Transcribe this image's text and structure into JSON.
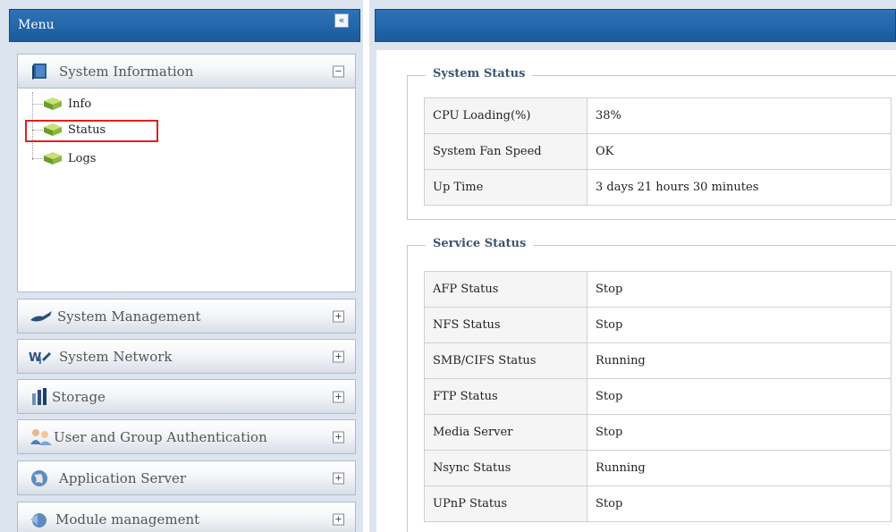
{
  "menu": {
    "title": "Menu",
    "collapse_icon": "double-chevron-left-icon",
    "sections": [
      {
        "label": "System Information",
        "icon": "book-icon",
        "toggle": "−",
        "expanded": true
      },
      {
        "label": "System Management",
        "icon": "wrench-icon",
        "toggle": "+"
      },
      {
        "label": "System Network",
        "icon": "network-icon",
        "toggle": "+"
      },
      {
        "label": "Storage",
        "icon": "storage-icon",
        "toggle": "+"
      },
      {
        "label": "User and Group Authentication",
        "icon": "users-icon",
        "toggle": "+"
      },
      {
        "label": "Application Server",
        "icon": "globe-icon",
        "toggle": "+"
      },
      {
        "label": "Module management",
        "icon": "module-icon",
        "toggle": "+"
      }
    ],
    "tree": [
      {
        "label": "Info",
        "icon": "cube-icon"
      },
      {
        "label": "Status",
        "icon": "cube-icon",
        "selected": true
      },
      {
        "label": "Logs",
        "icon": "cube-icon"
      }
    ]
  },
  "system_status": {
    "legend": "System Status",
    "rows": [
      {
        "label": "CPU Loading(%)",
        "value": "38%"
      },
      {
        "label": "System Fan Speed",
        "value": "OK"
      },
      {
        "label": "Up Time",
        "value": "3 days 21 hours 30 minutes"
      }
    ]
  },
  "service_status": {
    "legend": "Service Status",
    "rows": [
      {
        "label": "AFP Status",
        "value": "Stop"
      },
      {
        "label": "NFS Status",
        "value": "Stop"
      },
      {
        "label": "SMB/CIFS Status",
        "value": "Running"
      },
      {
        "label": "FTP Status",
        "value": "Stop"
      },
      {
        "label": "Media Server",
        "value": "Stop"
      },
      {
        "label": "Nsync Status",
        "value": "Running"
      },
      {
        "label": "UPnP Status",
        "value": "Stop"
      }
    ]
  },
  "colors": {
    "header_blue": "#1b5a9b",
    "panel_bg": "#dbe4ef",
    "stop_red": "#d42a2a",
    "running_blue": "#1f3bb3",
    "highlight_red": "#e02020"
  }
}
